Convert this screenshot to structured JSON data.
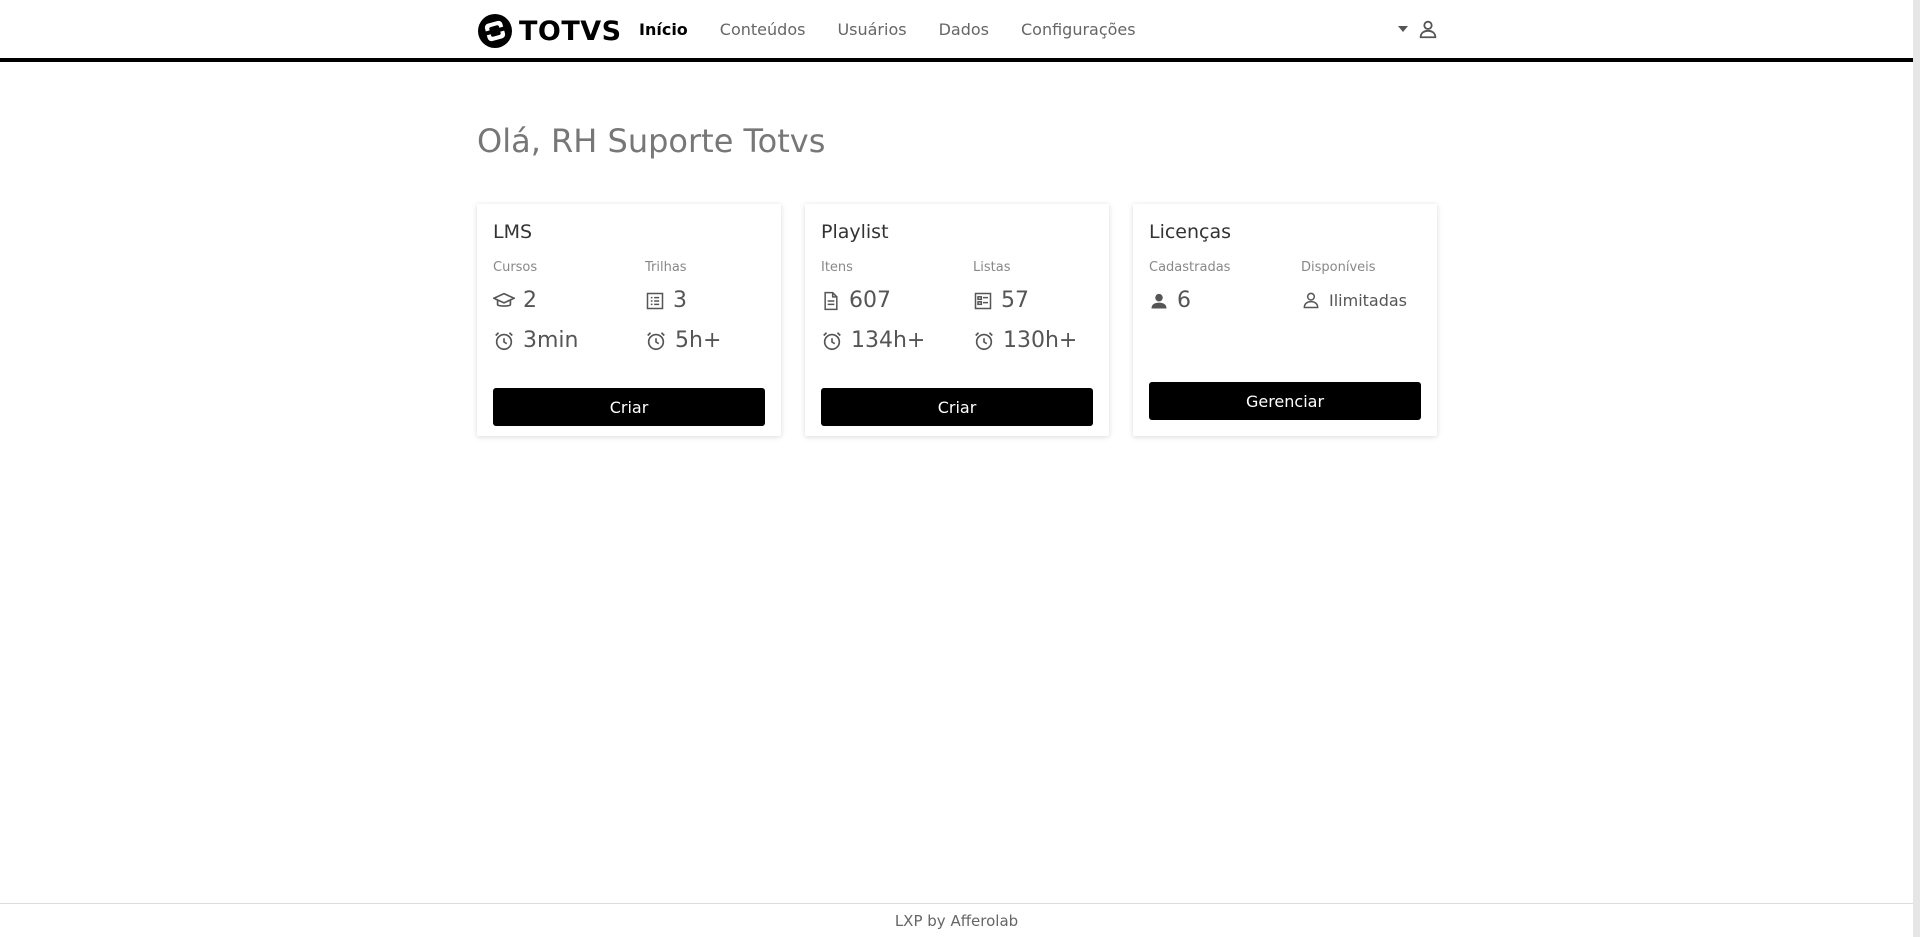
{
  "header": {
    "logo_text": "TOTVS",
    "nav": [
      {
        "label": "Início",
        "active": true
      },
      {
        "label": "Conteúdos",
        "active": false
      },
      {
        "label": "Usuários",
        "active": false
      },
      {
        "label": "Dados",
        "active": false
      },
      {
        "label": "Configurações",
        "active": false
      }
    ]
  },
  "main": {
    "greeting": "Olá, RH Suporte Totvs",
    "cards": [
      {
        "title": "LMS",
        "columns": [
          {
            "label": "Cursos",
            "count": "2",
            "count_icon": "graduation-cap-icon",
            "time": "3min",
            "time_icon": "alarm-clock-icon"
          },
          {
            "label": "Trilhas",
            "count": "3",
            "count_icon": "list-icon",
            "time": "5h+",
            "time_icon": "alarm-clock-icon"
          }
        ],
        "button": "Criar"
      },
      {
        "title": "Playlist",
        "columns": [
          {
            "label": "Itens",
            "count": "607",
            "count_icon": "document-icon",
            "time": "134h+",
            "time_icon": "alarm-clock-icon"
          },
          {
            "label": "Listas",
            "count": "57",
            "count_icon": "checklist-icon",
            "time": "130h+",
            "time_icon": "alarm-clock-icon"
          }
        ],
        "button": "Criar"
      },
      {
        "title": "Licenças",
        "columns": [
          {
            "label": "Cadastradas",
            "count": "6",
            "count_icon": "person-filled-icon"
          },
          {
            "label": "Disponíveis",
            "count": "Ilimitadas",
            "count_icon": "person-outline-icon"
          }
        ],
        "button": "Gerenciar"
      }
    ]
  },
  "footer": {
    "text": "LXP by Afferolab"
  },
  "colors": {
    "accent": "#000000",
    "text_muted": "#888888",
    "greeting": "#777777"
  }
}
